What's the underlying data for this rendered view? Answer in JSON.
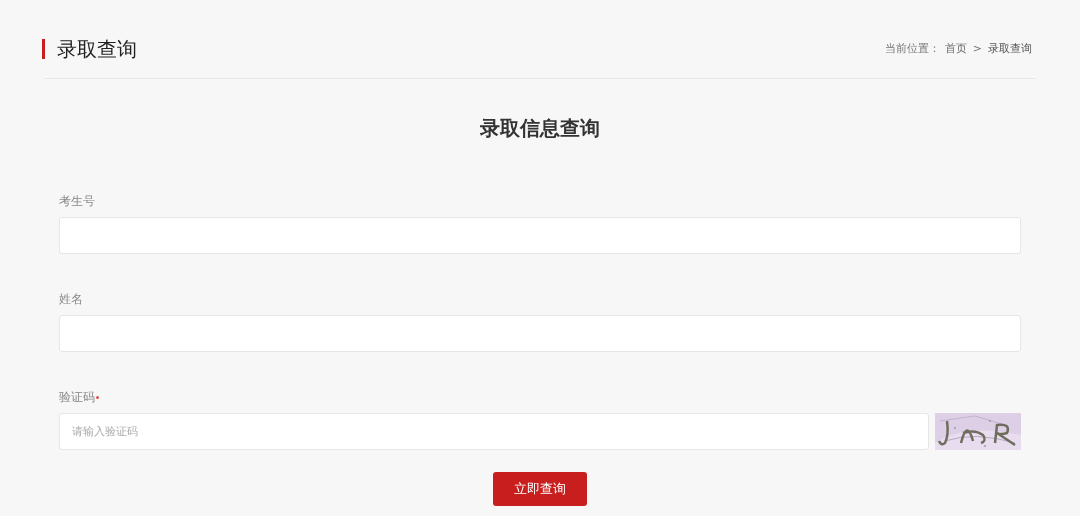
{
  "header": {
    "title": "录取查询",
    "breadcrumb": [
      {
        "text": "当前位置：",
        "kind": "label"
      },
      {
        "text": "首页",
        "kind": "link"
      },
      {
        "text": ">",
        "kind": "separator"
      },
      {
        "text": "录取查询",
        "kind": "current"
      }
    ]
  },
  "form": {
    "title": "录取信息查询",
    "fields": [
      {
        "label": "考生号",
        "required": false,
        "kind": "text"
      },
      {
        "label": "姓名",
        "required": false,
        "kind": "text"
      },
      {
        "label": "验证码",
        "required": true,
        "kind": "captcha",
        "placeholder": "请输入验证码"
      }
    ],
    "submit": "立即查询"
  }
}
